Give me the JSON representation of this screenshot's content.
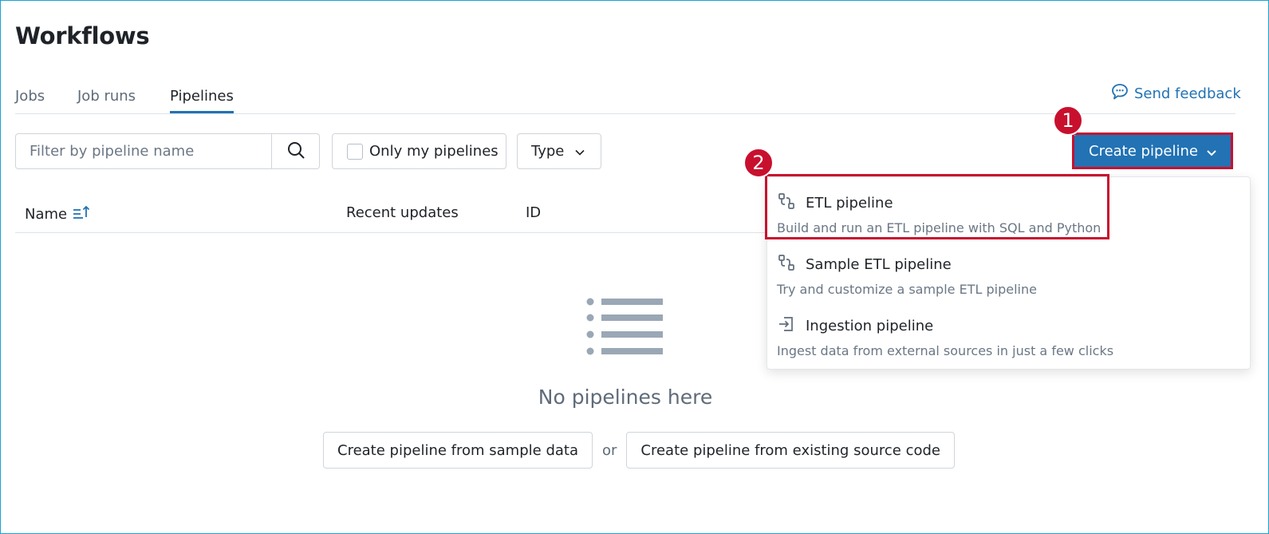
{
  "page": {
    "title": "Workflows"
  },
  "tabs": [
    {
      "label": "Jobs",
      "active": false
    },
    {
      "label": "Job runs",
      "active": false
    },
    {
      "label": "Pipelines",
      "active": true
    }
  ],
  "feedback": {
    "label": "Send feedback",
    "icon": "chat-bubble-icon"
  },
  "toolbar": {
    "filter_placeholder": "Filter by pipeline name",
    "only_mine_label": "Only my pipelines",
    "type_label": "Type",
    "create_label": "Create pipeline"
  },
  "table": {
    "columns": [
      "Name",
      "Recent updates",
      "ID"
    ]
  },
  "empty_state": {
    "message": "No pipelines here",
    "sample_button": "Create pipeline from sample data",
    "or_text": "or",
    "existing_button": "Create pipeline from existing source code"
  },
  "dropdown": {
    "items": [
      {
        "title": "ETL pipeline",
        "description": "Build and run an ETL pipeline with SQL and Python",
        "icon": "pipeline-icon"
      },
      {
        "title": "Sample ETL pipeline",
        "description": "Try and customize a sample ETL pipeline",
        "icon": "pipeline-icon"
      },
      {
        "title": "Ingestion pipeline",
        "description": "Ingest data from external sources in just a few clicks",
        "icon": "ingest-icon"
      }
    ]
  },
  "annotations": {
    "badge_1": "1",
    "badge_2": "2",
    "color": "#c8102e"
  },
  "colors": {
    "accent": "#2272b4",
    "text": "#1f2328",
    "muted": "#5f6b7a"
  }
}
